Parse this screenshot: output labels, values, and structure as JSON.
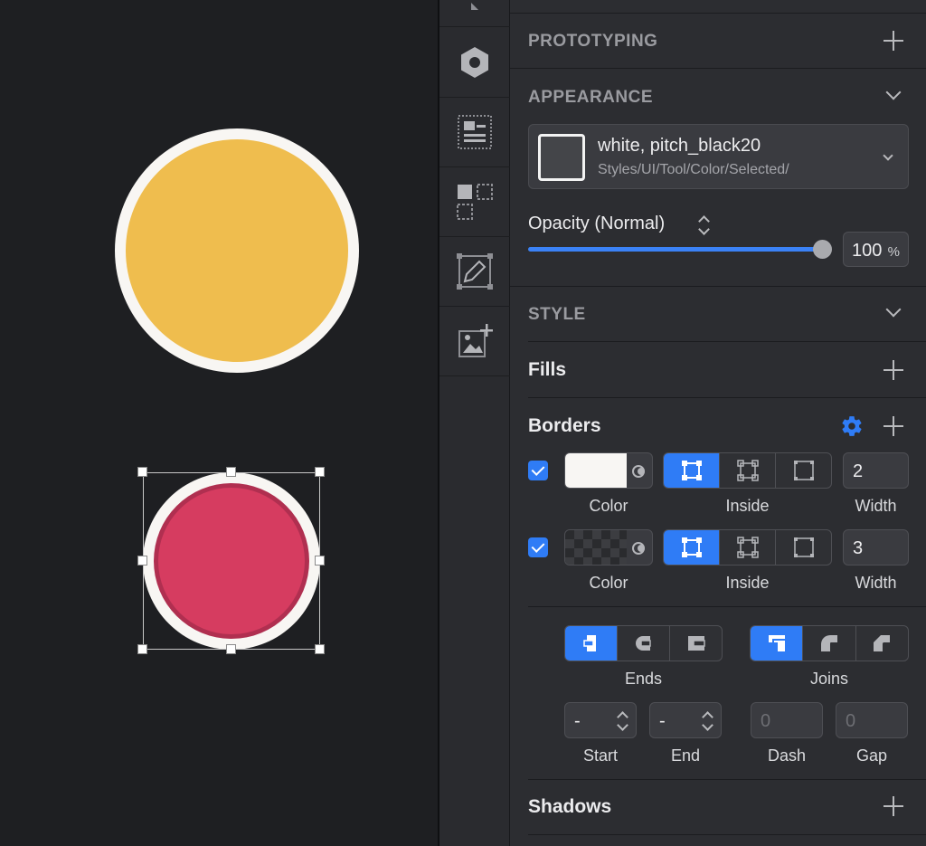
{
  "panel": {
    "prototyping_title": "PROTOTYPING",
    "appearance_title": "APPEARANCE",
    "style_name": "white, pitch_black20",
    "style_path": "Styles/UI/Tool/Color/Selected/",
    "opacity_label": "Opacity (Normal)",
    "opacity_value": "100",
    "opacity_unit": "%",
    "opacity_fraction": 1.0,
    "style_title": "STYLE",
    "fills_title": "Fills",
    "borders_title": "Borders",
    "borders": [
      {
        "enabled": true,
        "color_label": "Color",
        "position_label": "Inside",
        "width": "2",
        "width_label": "Width",
        "color": "#f8f6f3"
      },
      {
        "enabled": true,
        "color_label": "Color",
        "position_label": "Inside",
        "width": "3",
        "width_label": "Width",
        "color": "transparent"
      }
    ],
    "ends_label": "Ends",
    "joins_label": "Joins",
    "start_value": "-",
    "start_label": "Start",
    "end_value": "-",
    "end_label": "End",
    "dash_value": "0",
    "dash_label": "Dash",
    "gap_value": "0",
    "gap_label": "Gap",
    "shadows_title": "Shadows"
  },
  "colors": {
    "accent": "#2f7cf6",
    "yellow_fill": "#efbd4e",
    "red_fill": "#d63c60",
    "red_border": "#b02f50",
    "white_border": "#f8f6f3"
  },
  "toolbar_icons": [
    "symbol-icon",
    "text-layout-icon",
    "components-icon",
    "edit-shape-icon",
    "add-image-icon"
  ]
}
